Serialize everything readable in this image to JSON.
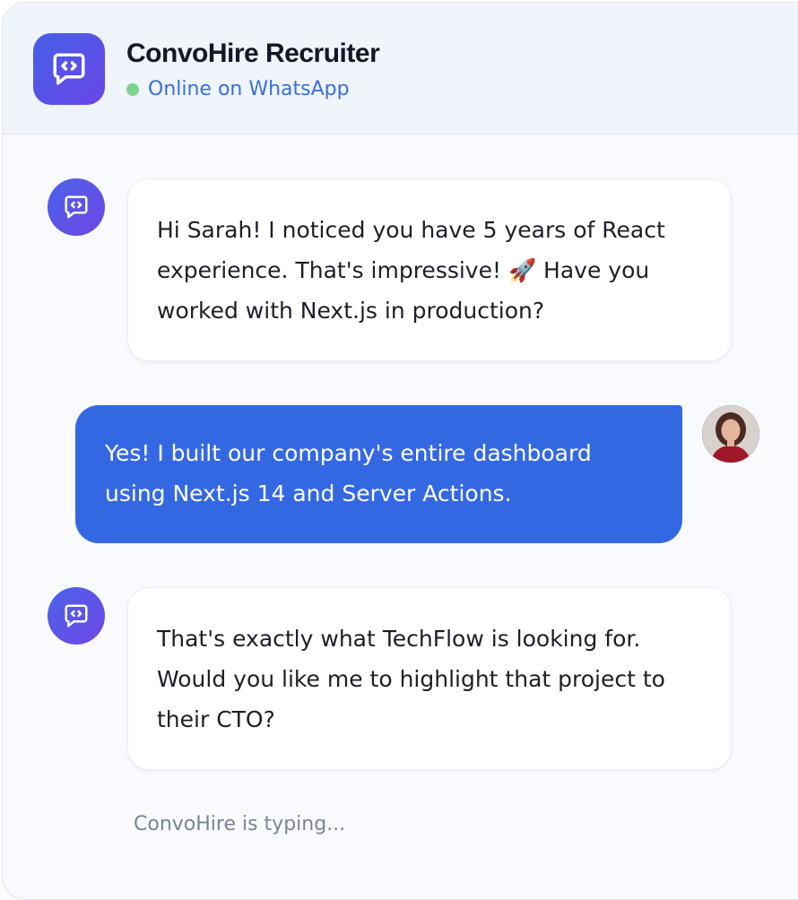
{
  "header": {
    "app_icon": "chat-code-icon",
    "title": "ConvoHire Recruiter",
    "status_text": "Online on WhatsApp",
    "status_color": "#7cd38c"
  },
  "messages": [
    {
      "sender": "bot",
      "avatar_icon": "chat-code-icon",
      "text": "Hi Sarah! I noticed you have 5 years of React experience. That's impressive! 🚀 Have you worked with Next.js in production?"
    },
    {
      "sender": "user",
      "avatar": "user-photo",
      "text": "Yes! I built our company's entire dashboard using Next.js 14 and Server Actions."
    },
    {
      "sender": "bot",
      "avatar_icon": "chat-code-icon",
      "text": "That's exactly what TechFlow is looking for. Would you like me to highlight that project to their CTO?"
    }
  ],
  "typing_indicator": "ConvoHire is typing...",
  "colors": {
    "accent": "#3468e3",
    "brand_gradient_start": "#4560e8",
    "brand_gradient_end": "#6a45e6"
  }
}
